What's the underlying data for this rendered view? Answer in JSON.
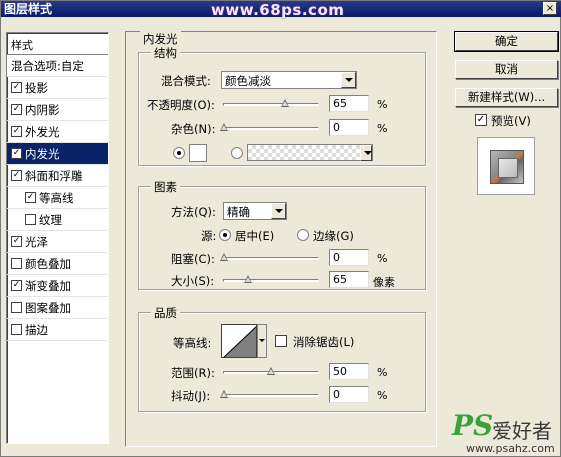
{
  "window": {
    "title": "图层样式",
    "watermark": "www.68ps.com",
    "close_label": "×"
  },
  "style_list": {
    "header": "样式",
    "blend_options": "混合选项:自定",
    "items": [
      {
        "label": "投影",
        "checked": "✓"
      },
      {
        "label": "内阴影",
        "checked": "✓"
      },
      {
        "label": "外发光",
        "checked": "✓"
      },
      {
        "label": "内发光",
        "checked": "✓"
      },
      {
        "label": "斜面和浮雕",
        "checked": "✓"
      },
      {
        "label": "等高线",
        "checked": "✓"
      },
      {
        "label": "纹理",
        "checked": ""
      },
      {
        "label": "光泽",
        "checked": "✓"
      },
      {
        "label": "颜色叠加",
        "checked": ""
      },
      {
        "label": "渐变叠加",
        "checked": "✓"
      },
      {
        "label": "图案叠加",
        "checked": ""
      },
      {
        "label": "描边",
        "checked": ""
      }
    ]
  },
  "panel": {
    "title": "内发光",
    "structure": {
      "title": "结构",
      "blend_mode_label": "混合模式:",
      "blend_mode_value": "颜色减淡",
      "opacity_label": "不透明度(O):",
      "opacity_value": "65",
      "opacity_fraction": 0.65,
      "noise_label": "杂色(N):",
      "noise_value": "0",
      "noise_fraction": 0.0,
      "percent": "%"
    },
    "elements": {
      "title": "图素",
      "method_label": "方法(Q):",
      "method_value": "精确",
      "source_label": "源:",
      "source_center": "居中(E)",
      "source_edge": "边缘(G)",
      "choke_label": "阻塞(C):",
      "choke_value": "0",
      "choke_fraction": 0.0,
      "size_label": "大小(S):",
      "size_value": "65",
      "size_fraction": 0.26,
      "size_unit": "像素",
      "percent": "%"
    },
    "quality": {
      "title": "品质",
      "contour_label": "等高线:",
      "antialias_label": "消除锯齿(L)",
      "range_label": "范围(R):",
      "range_value": "50",
      "range_fraction": 0.5,
      "jitter_label": "抖动(J):",
      "jitter_value": "0",
      "jitter_fraction": 0.0,
      "percent": "%"
    }
  },
  "buttons": {
    "ok": "确定",
    "cancel": "取消",
    "new_style": "新建样式(W)...",
    "preview_label": "预览(V)",
    "preview_checked": "✓"
  },
  "logo": {
    "ps": "PS",
    "name": "爱好者",
    "url": "www.psahz.com"
  }
}
